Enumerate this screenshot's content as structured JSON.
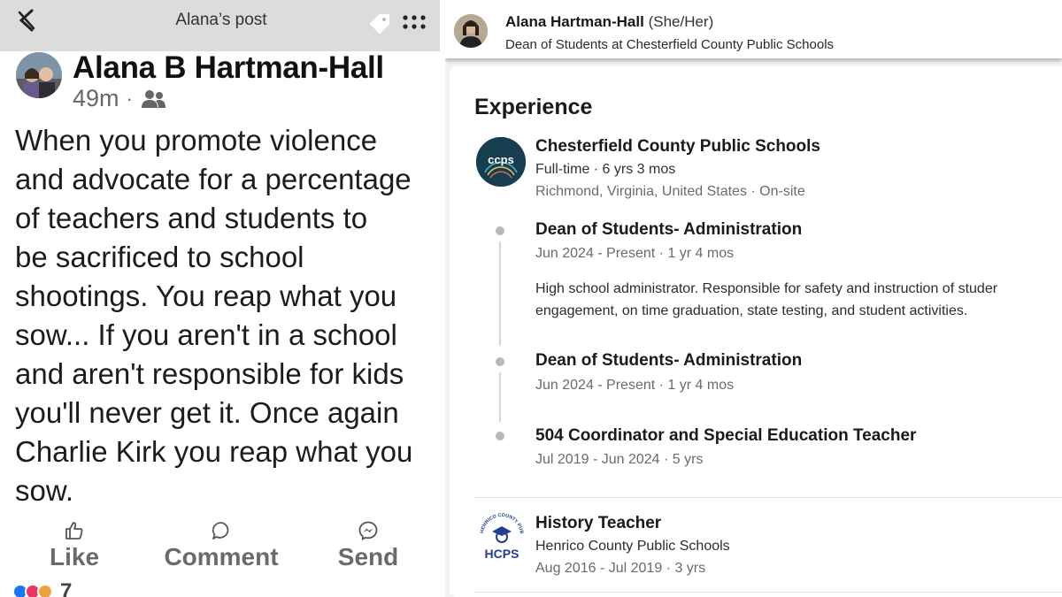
{
  "facebook": {
    "header_title": "Alana’s post",
    "author": "Alana B Hartman-Hall",
    "time": "49m",
    "separator": "·",
    "body_lines": [
      "When you promote violence",
      "and advocate for a percentage",
      "of teachers and students to",
      "be sacrificed to school",
      "shootings. You reap what you",
      "sow... If you aren't in a school",
      "and aren't responsible for kids",
      "you'll never get it. Once again",
      "Charlie Kirk you reap what you",
      "sow."
    ],
    "actions": {
      "like": "Like",
      "comment": "Comment",
      "send": "Send"
    },
    "reaction_count": "7",
    "icons": [
      "back-icon",
      "tag-icon",
      "more-icon",
      "friends-audience-icon",
      "thumbs-up-icon",
      "comment-icon",
      "messenger-icon"
    ]
  },
  "linkedin": {
    "name": "Alana Hartman-Hall",
    "pronouns": "(She/Her)",
    "headline": "Dean of Students at Chesterfield County Public Schools",
    "section_title": "Experience",
    "company": {
      "name": "Chesterfield County Public Schools",
      "logo_text": "ccps",
      "employment": "Full-time · 6 yrs 3 mos",
      "location": "Richmond, Virginia, United States · On-site"
    },
    "roles": [
      {
        "title": "Dean of Students- Administration",
        "dates": "Jun 2024 - Present · 1 yr 4 mos",
        "description_lines": [
          "High school administrator. Responsible for safety and instruction of studer",
          "engagement, on time graduation, state testing, and student activities."
        ]
      },
      {
        "title": "Dean of Students- Administration",
        "dates": "Jun 2024 - Present · 1 yr 4 mos"
      },
      {
        "title": "504 Coordinator and Special Education Teacher",
        "dates": "Jul 2019 - Jun 2024 · 5 yrs"
      }
    ],
    "history": {
      "title": "History Teacher",
      "org": "Henrico County Public Schools",
      "dates": "Aug 2016 - Jul 2019 · 3 yrs",
      "logo_text": "HCPS",
      "logo_ring_text": "HENRICO COUNTY PUBLIC SCHOOLS"
    }
  },
  "colors": {
    "fb_header_bg": "#dcdcdc",
    "li_page_bg": "#f3f2ef",
    "ccps_logo_bg": "#173e4f",
    "hcps_blue": "#1f3f8f"
  }
}
